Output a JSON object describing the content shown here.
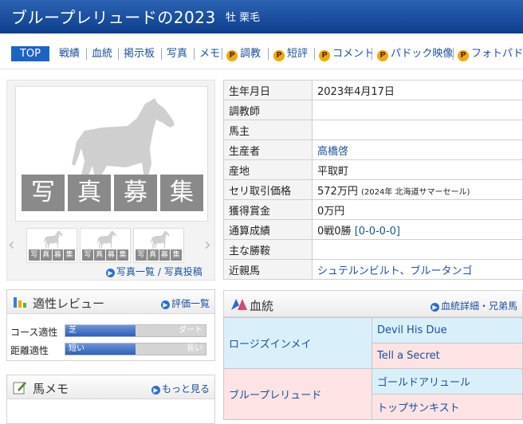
{
  "header": {
    "horse_name": "ブループレリュードの2023",
    "sex_color": "牡  栗毛"
  },
  "nav": {
    "top": "TOP",
    "items": [
      "戦績",
      "血統",
      "掲示板",
      "写真",
      "メモ",
      "調教",
      "短評",
      "コメント",
      "パドック映像",
      "フォトパドック"
    ],
    "premium_badge": "P"
  },
  "photo": {
    "recruit_chars": [
      "写",
      "真",
      "募",
      "集"
    ],
    "thumb_label": [
      "写",
      "真",
      "募",
      "集"
    ],
    "links": {
      "list": "写真一覧",
      "sep": "/",
      "post": "写真投稿"
    },
    "prev": "‹",
    "next": "›"
  },
  "info": {
    "rows": [
      {
        "k": "生年月日",
        "v": "2023年4月17日",
        "link": false
      },
      {
        "k": "調教師",
        "v": "",
        "link": false
      },
      {
        "k": "馬主",
        "v": "",
        "link": false
      },
      {
        "k": "生産者",
        "v": "高橋啓",
        "link": true
      },
      {
        "k": "産地",
        "v": "平取町",
        "link": false
      },
      {
        "k": "セリ取引価格",
        "v": "572万円",
        "note": "(2024年 北海道サマーセール)",
        "link": false
      },
      {
        "k": "獲得賞金",
        "v": "0万円",
        "link": false
      },
      {
        "k": "通算成績",
        "v": "0戦0勝",
        "record": "[0-0-0-0]",
        "link": false
      },
      {
        "k": "主な勝鞍",
        "v": "",
        "link": false
      },
      {
        "k": "近親馬",
        "v": "シュテルンビルト、ブルータンゴ",
        "link": true
      }
    ]
  },
  "aptitude": {
    "title": "適性レビュー",
    "more": "評価一覧",
    "rows": [
      {
        "label": "コース適性",
        "left": "芝",
        "right": "ダート",
        "level": 0.5
      },
      {
        "label": "距離適性",
        "left": "短い",
        "right": "長い",
        "level": 0.5
      }
    ]
  },
  "memo": {
    "title": "馬メモ",
    "more": "もっと見る"
  },
  "pedigree": {
    "title": "血統",
    "more": "血統詳細・兄弟馬",
    "sire": "ロージズインメイ",
    "sire_sire": "Devil His Due",
    "sire_dam": "Tell a Secret",
    "dam": "ブループレリュード",
    "dam_sire": "ゴールドアリュール",
    "dam_dam": "トップサンキスト"
  },
  "colors": {
    "header": "#0d3e8c",
    "link": "#1a4f9c",
    "male_bg": "#d9f0fb",
    "female_bg": "#fde3e3",
    "premium": "#f0a900"
  }
}
